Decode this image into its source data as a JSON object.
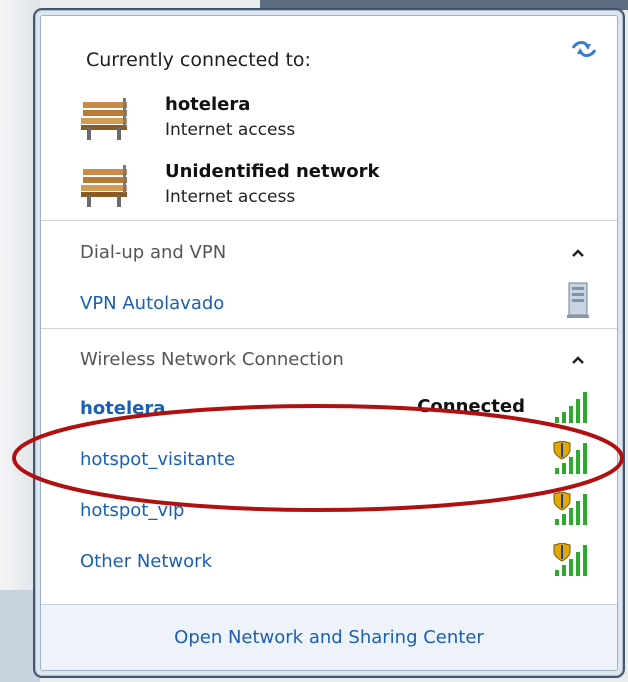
{
  "connected": {
    "header": "Currently connected to:",
    "networks": [
      {
        "name": "hotelera",
        "status": "Internet access",
        "icon": "bench-network-icon"
      },
      {
        "name": "Unidentified network",
        "status": "Internet access",
        "icon": "bench-network-icon"
      }
    ]
  },
  "dialup": {
    "header": "Dial-up and VPN",
    "items": [
      {
        "name": "VPN Autolavado",
        "icon": "vpn-server-icon"
      }
    ]
  },
  "wireless": {
    "header": "Wireless Network Connection",
    "items": [
      {
        "name": "hotelera",
        "status": "Connected",
        "secured": false,
        "signal_bars": 5
      },
      {
        "name": "hotspot_visitante",
        "status": "",
        "secured": true,
        "signal_bars": 5
      },
      {
        "name": "hotspot_vip",
        "status": "",
        "secured": true,
        "signal_bars": 5
      },
      {
        "name": "Other Network",
        "status": "",
        "secured": true,
        "signal_bars": 5
      }
    ]
  },
  "footer": {
    "link": "Open Network and Sharing Center"
  },
  "colors": {
    "link": "#1a5fb4",
    "signal": "#2ea82e",
    "shield": "#e0a800",
    "annotation": "#b01010"
  }
}
